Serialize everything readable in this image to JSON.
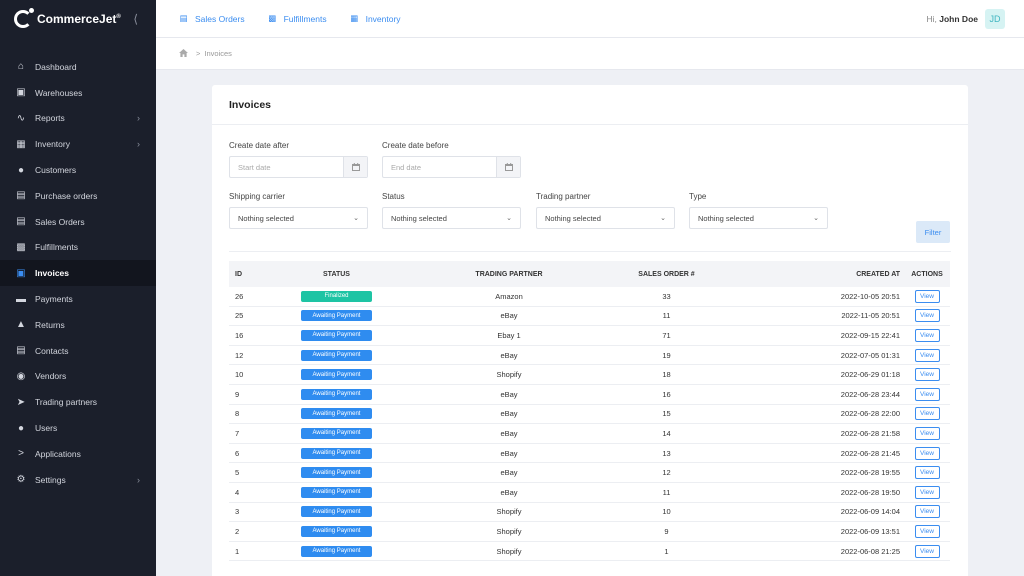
{
  "brand": {
    "name": "CommerceJet",
    "mark": "®"
  },
  "nav": [
    {
      "label": "Dashboard",
      "icon": "home-icon",
      "chevron": false,
      "active": false
    },
    {
      "label": "Warehouses",
      "icon": "warehouse-icon",
      "chevron": false,
      "active": false
    },
    {
      "label": "Reports",
      "icon": "chart-icon",
      "chevron": true,
      "active": false
    },
    {
      "label": "Inventory",
      "icon": "boxes-icon",
      "chevron": true,
      "active": false
    },
    {
      "label": "Customers",
      "icon": "users-icon",
      "chevron": false,
      "active": false
    },
    {
      "label": "Purchase orders",
      "icon": "file-import-icon",
      "chevron": false,
      "active": false
    },
    {
      "label": "Sales Orders",
      "icon": "file-export-icon",
      "chevron": false,
      "active": false
    },
    {
      "label": "Fulfillments",
      "icon": "truck-loading-icon",
      "chevron": false,
      "active": false
    },
    {
      "label": "Invoices",
      "icon": "invoice-icon",
      "chevron": false,
      "active": true
    },
    {
      "label": "Payments",
      "icon": "money-icon",
      "chevron": false,
      "active": false
    },
    {
      "label": "Returns",
      "icon": "return-icon",
      "chevron": false,
      "active": false
    },
    {
      "label": "Contacts",
      "icon": "address-book-icon",
      "chevron": false,
      "active": false
    },
    {
      "label": "Vendors",
      "icon": "vendor-icon",
      "chevron": false,
      "active": false
    },
    {
      "label": "Trading partners",
      "icon": "rocket-icon",
      "chevron": false,
      "active": false
    },
    {
      "label": "Users",
      "icon": "users-group-icon",
      "chevron": false,
      "active": false
    },
    {
      "label": "Applications",
      "icon": "terminal-icon",
      "chevron": false,
      "active": false
    },
    {
      "label": "Settings",
      "icon": "cogs-icon",
      "chevron": true,
      "active": false
    }
  ],
  "topbar": {
    "links": [
      {
        "label": "Sales Orders",
        "icon": "file-export-icon"
      },
      {
        "label": "Fulfillments",
        "icon": "truck-loading-icon"
      },
      {
        "label": "Inventory",
        "icon": "boxes-icon"
      }
    ],
    "greeting": "Hi,",
    "user_name": "John Doe",
    "avatar_initials": "JD"
  },
  "breadcrumb": {
    "current": "Invoices"
  },
  "page": {
    "title": "Invoices"
  },
  "filters": {
    "create_after": {
      "label": "Create date after",
      "placeholder": "Start date"
    },
    "create_before": {
      "label": "Create date before",
      "placeholder": "End date"
    },
    "shipping_carrier": {
      "label": "Shipping carrier",
      "value": "Nothing selected"
    },
    "status": {
      "label": "Status",
      "value": "Nothing selected"
    },
    "trading_partner": {
      "label": "Trading partner",
      "value": "Nothing selected"
    },
    "type": {
      "label": "Type",
      "value": "Nothing selected"
    },
    "filter_button": "Filter"
  },
  "table": {
    "headers": {
      "id": "ID",
      "status": "STATUS",
      "partner": "TRADING PARTNER",
      "sales_order": "SALES ORDER #",
      "created_at": "CREATED AT",
      "actions": "ACTIONS"
    },
    "view_label": "View",
    "status_colors": {
      "Finalized": "#1ec4a4",
      "Awaiting Payment": "#2f8cf0"
    },
    "rows": [
      {
        "id": "26",
        "status": "Finalized",
        "partner": "Amazon",
        "sales_order": "33",
        "created_at": "2022-10-05 20:51"
      },
      {
        "id": "25",
        "status": "Awaiting Payment",
        "partner": "eBay",
        "sales_order": "11",
        "created_at": "2022-11-05 20:51"
      },
      {
        "id": "16",
        "status": "Awaiting Payment",
        "partner": "Ebay 1",
        "sales_order": "71",
        "created_at": "2022-09-15 22:41"
      },
      {
        "id": "12",
        "status": "Awaiting Payment",
        "partner": "eBay",
        "sales_order": "19",
        "created_at": "2022-07-05 01:31"
      },
      {
        "id": "10",
        "status": "Awaiting Payment",
        "partner": "Shopify",
        "sales_order": "18",
        "created_at": "2022-06-29 01:18"
      },
      {
        "id": "9",
        "status": "Awaiting Payment",
        "partner": "eBay",
        "sales_order": "16",
        "created_at": "2022-06-28 23:44"
      },
      {
        "id": "8",
        "status": "Awaiting Payment",
        "partner": "eBay",
        "sales_order": "15",
        "created_at": "2022-06-28 22:00"
      },
      {
        "id": "7",
        "status": "Awaiting Payment",
        "partner": "eBay",
        "sales_order": "14",
        "created_at": "2022-06-28 21:58"
      },
      {
        "id": "6",
        "status": "Awaiting Payment",
        "partner": "eBay",
        "sales_order": "13",
        "created_at": "2022-06-28 21:45"
      },
      {
        "id": "5",
        "status": "Awaiting Payment",
        "partner": "eBay",
        "sales_order": "12",
        "created_at": "2022-06-28 19:55"
      },
      {
        "id": "4",
        "status": "Awaiting Payment",
        "partner": "eBay",
        "sales_order": "11",
        "created_at": "2022-06-28 19:50"
      },
      {
        "id": "3",
        "status": "Awaiting Payment",
        "partner": "Shopify",
        "sales_order": "10",
        "created_at": "2022-06-09 14:04"
      },
      {
        "id": "2",
        "status": "Awaiting Payment",
        "partner": "Shopify",
        "sales_order": "9",
        "created_at": "2022-06-09 13:51"
      },
      {
        "id": "1",
        "status": "Awaiting Payment",
        "partner": "Shopify",
        "sales_order": "1",
        "created_at": "2022-06-08 21:25"
      }
    ]
  }
}
